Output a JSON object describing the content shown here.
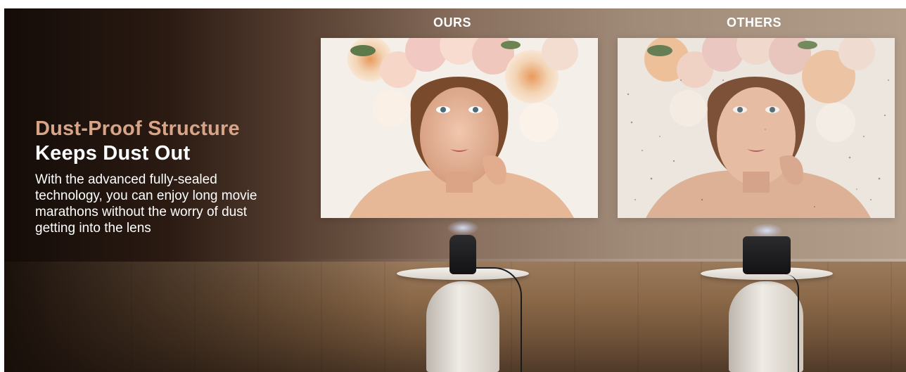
{
  "headline": {
    "line1": "Dust-Proof Structure",
    "line2": "Keeps Dust Out"
  },
  "description": "With the advanced fully-sealed technology, you can enjoy long movie marathons without the worry of dust getting into the lens",
  "comparison": {
    "left_label": "OURS",
    "right_label": "OTHERS"
  },
  "colors": {
    "accent": "#d7a488",
    "text": "#ffffff"
  }
}
